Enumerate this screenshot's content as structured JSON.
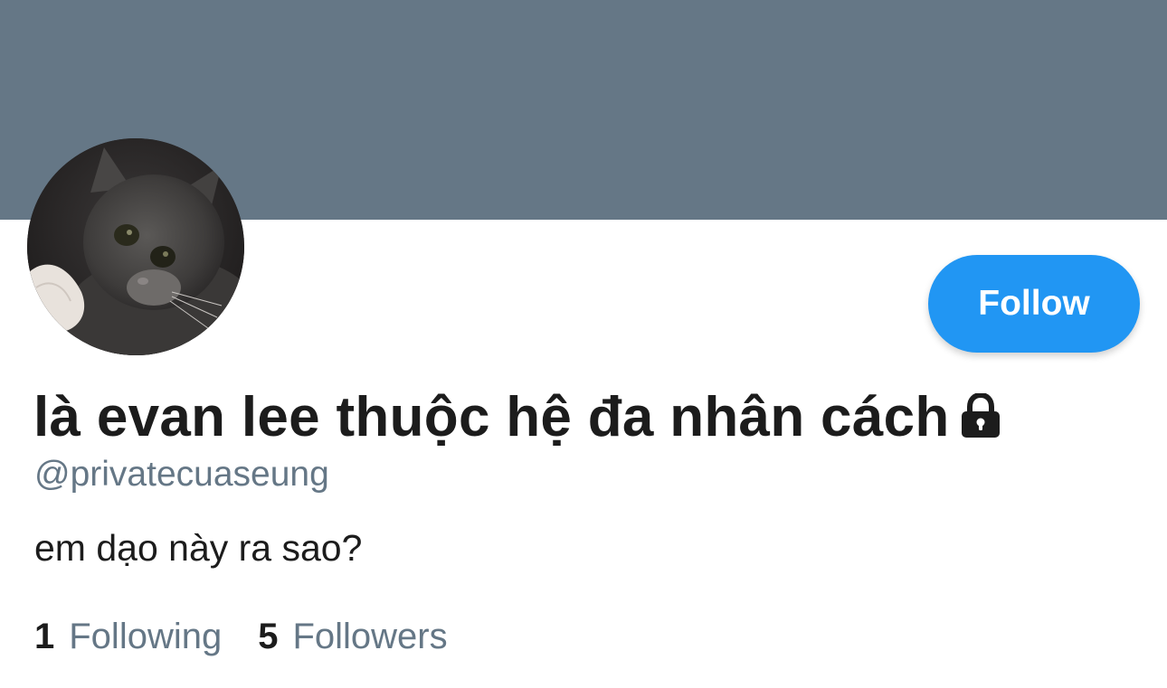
{
  "profile": {
    "display_name": "là evan lee thuộc hệ đa nhân cách",
    "handle": "@privatecuaseung",
    "bio": "em dạo này ra sao?",
    "locked_icon": "lock-icon",
    "avatar_desc": "avatar"
  },
  "actions": {
    "follow_label": "Follow"
  },
  "stats": {
    "following_count": "1",
    "following_label": "Following",
    "followers_count": "5",
    "followers_label": "Followers"
  },
  "colors": {
    "banner": "#657786",
    "accent": "#2196f3",
    "text_primary": "#1c1c1c",
    "text_secondary": "#657786"
  }
}
